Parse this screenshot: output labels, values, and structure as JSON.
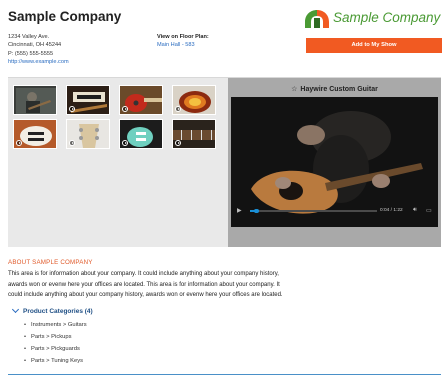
{
  "company": {
    "name": "Sample Company",
    "address1": "1234 Valley Ave.",
    "address2": "Cincinnati, OH 45244",
    "phone": "P: (555) 555-5555",
    "url": "http://www.example.com"
  },
  "floor_plan": {
    "label": "View on Floor Plan:",
    "location": "Main Hall - 583"
  },
  "logo": {
    "text": "Sample Company",
    "icon": "sample-company-logo-icon",
    "colors": {
      "green": "#4a9a34",
      "orange": "#f15a22"
    }
  },
  "actions": {
    "add_to_show_label": "Add to My Show",
    "accent": "#f15a22"
  },
  "gallery": {
    "thumbnails": [
      {
        "subject": "guitarist video still",
        "video": false
      },
      {
        "subject": "guitar with shop sign",
        "video": true
      },
      {
        "subject": "red guitar",
        "video": true
      },
      {
        "subject": "sunburst guitar body",
        "video": true
      },
      {
        "subject": "white guitar body",
        "video": true
      },
      {
        "subject": "headstock with tuning keys",
        "video": true
      },
      {
        "subject": "teal guitar body",
        "video": true
      },
      {
        "subject": "guitar neck frets",
        "video": true
      }
    ]
  },
  "player": {
    "star_icon": "star-outline-icon",
    "title": "Haywire Custom Guitar",
    "time": "0:04 / 1:22",
    "progress": 0.05,
    "icons": [
      "play-icon",
      "volume-icon",
      "fullscreen-icon"
    ]
  },
  "about": {
    "title": "ABOUT SAMPLE COMPANY",
    "lines": [
      "This area is for information about your company. It could include anything about your company history,",
      "awards won or evenw here your offices are located. This area is for information about your company. It",
      "could include anything about your company history, awards won or evenw here your offices are located."
    ]
  },
  "categories": {
    "heading": "Product Categories (4)",
    "items": [
      "Instruments > Guitars",
      "Parts > Pickups",
      "Parts > Pickguards",
      "Parts > Tuning Keys"
    ]
  }
}
